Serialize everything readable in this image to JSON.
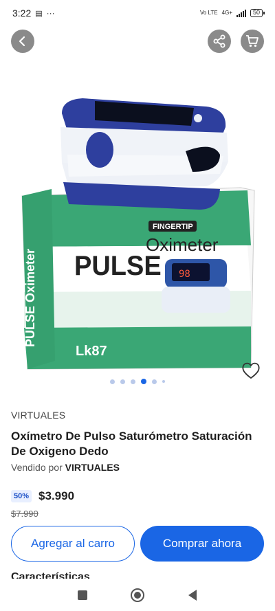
{
  "status_bar": {
    "time": "3:22",
    "network": "Vo LTE",
    "network_type": "4G+",
    "battery": "50"
  },
  "top_bar": {
    "back_icon": "chevron-left-icon",
    "share_icon": "share-icon",
    "cart_icon": "shopping-cart-icon"
  },
  "product_image": {
    "box_brand": "PULSE",
    "box_badge": "FINGERTIP",
    "box_product": "Oximeter",
    "box_side": "PULSE Oximeter",
    "box_model": "Lk87",
    "display_reading": "98"
  },
  "carousel": {
    "count": 6,
    "active_index": 3
  },
  "product": {
    "brand": "VIRTUALES",
    "title": "Oxímetro De Pulso Saturómetro Saturación De Oxigeno Dedo",
    "sold_by_label": "Vendido por",
    "seller": "VIRTUALES",
    "discount": "50%",
    "price": "$3.990",
    "old_price": "$7.990"
  },
  "actions": {
    "add_to_cart": "Agregar al carro",
    "buy_now": "Comprar ahora"
  },
  "section": {
    "next_title": "Características"
  },
  "colors": {
    "accent": "#1a66e5",
    "box_green": "#3aa775"
  }
}
